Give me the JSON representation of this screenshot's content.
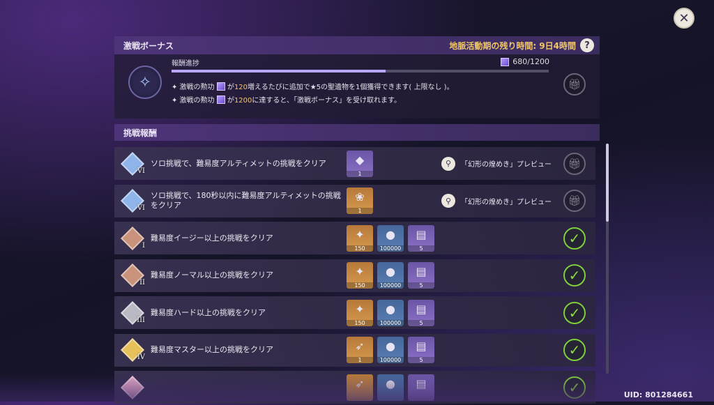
{
  "close_glyph": "✕",
  "header": {
    "title": "激戦ボーナス",
    "time_label": "地脈活動期の残り時間: 9日4時間",
    "help_glyph": "?"
  },
  "bonus": {
    "emblem_icon": "wand-icon",
    "progress_label": "報酬進捗",
    "progress_value": "680/1200",
    "progress_fraction": 0.567,
    "line1": {
      "prefix": "✦ 激戦の勲功",
      "mid": "が",
      "num": "120",
      "suffix": "増えるたびに追加で★5の聖遺物を1個獲得できます( 上限なし )。"
    },
    "line2": {
      "prefix": "✦ 激戦の勲功",
      "mid": "が",
      "num": "1200",
      "suffix": "に達すると、「激戦ボーナス」を受け取れます。"
    }
  },
  "section_title": "挑戦報酬",
  "rows": [
    {
      "badge_roman": "VI",
      "badge_color": "#8fb4ea",
      "desc": "ソロ挑戦で、難易度アルティメットの挑戦をクリア",
      "items": [
        {
          "style": "purple",
          "glyph": "◆",
          "count": "1"
        }
      ],
      "preview": "「幻形の煌めき」プレビュー",
      "status": "gift"
    },
    {
      "badge_roman": "VI",
      "badge_color": "#8fb4ea",
      "desc": "ソロ挑戦で、180秒以内に難易度アルティメットの挑戦をクリア",
      "items": [
        {
          "style": "gold",
          "glyph": "❀",
          "count": "1"
        }
      ],
      "preview": "「幻形の煌めき」プレビュー",
      "status": "gift"
    },
    {
      "badge_roman": "I",
      "badge_color": "#c9927a",
      "desc": "難易度イージー以上の挑戦をクリア",
      "items": [
        {
          "style": "gold",
          "glyph": "✦",
          "count": "150"
        },
        {
          "style": "blue",
          "glyph": "●",
          "count": "100000"
        },
        {
          "style": "purple",
          "glyph": "▤",
          "count": "5"
        }
      ],
      "status": "claimed"
    },
    {
      "badge_roman": "II",
      "badge_color": "#c9927a",
      "desc": "難易度ノーマル以上の挑戦をクリア",
      "items": [
        {
          "style": "gold",
          "glyph": "✦",
          "count": "150"
        },
        {
          "style": "blue",
          "glyph": "●",
          "count": "100000"
        },
        {
          "style": "purple",
          "glyph": "▤",
          "count": "5"
        }
      ],
      "status": "claimed"
    },
    {
      "badge_roman": "III",
      "badge_color": "#b9b9c4",
      "desc": "難易度ハード以上の挑戦をクリア",
      "items": [
        {
          "style": "gold",
          "glyph": "✦",
          "count": "150"
        },
        {
          "style": "blue",
          "glyph": "●",
          "count": "100000"
        },
        {
          "style": "purple",
          "glyph": "▤",
          "count": "5"
        }
      ],
      "status": "claimed"
    },
    {
      "badge_roman": "IV",
      "badge_color": "#e6c15a",
      "desc": "難易度マスター以上の挑戦をクリア",
      "items": [
        {
          "style": "gold",
          "glyph": "➶",
          "count": "1"
        },
        {
          "style": "blue",
          "glyph": "●",
          "count": "100000"
        },
        {
          "style": "purple",
          "glyph": "▤",
          "count": "5"
        }
      ],
      "status": "claimed"
    },
    {
      "badge_roman": "",
      "badge_color": "#e7a9c9",
      "desc": "",
      "items": [
        {
          "style": "gold",
          "glyph": "➶",
          "count": ""
        },
        {
          "style": "blue",
          "glyph": "●",
          "count": ""
        },
        {
          "style": "purple",
          "glyph": "▤",
          "count": ""
        }
      ],
      "status": "claimed"
    }
  ],
  "uid": "UID: 801284661"
}
